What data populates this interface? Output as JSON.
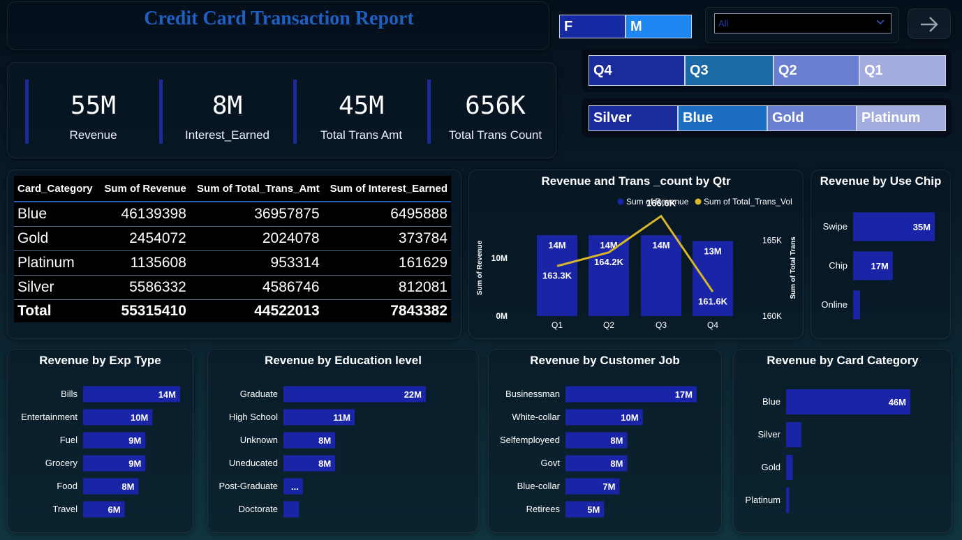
{
  "report_title": "Credit Card Transaction Report",
  "gender_slicer": {
    "options": [
      "F",
      "M"
    ]
  },
  "dropdown": {
    "value": "All"
  },
  "quarter_slicer": {
    "options": [
      "Q4",
      "Q3",
      "Q2",
      "Q1"
    ],
    "colors": [
      "#1a2c9c",
      "#1b6aa6",
      "#6b7fd0",
      "#a3acdf"
    ]
  },
  "category_slicer": {
    "options": [
      "Silver",
      "Blue",
      "Gold",
      "Platinum"
    ],
    "colors": [
      "#1a2c9c",
      "#1b6ec4",
      "#6b7fd0",
      "#a3acdf"
    ]
  },
  "kpis": [
    {
      "value": "55M",
      "label": "Revenue"
    },
    {
      "value": "8M",
      "label": "Interest_Earned"
    },
    {
      "value": "45M",
      "label": "Total Trans Amt"
    },
    {
      "value": "656K",
      "label": "Total Trans Count"
    }
  ],
  "colors": {
    "bar": "#1a24a6",
    "line": "#d9b72a",
    "title": "#1f5fc0"
  },
  "chart_data": [
    {
      "type": "table",
      "columns": [
        "Card_Category",
        "Sum of Revenue",
        "Sum of Total_Trans_Amt",
        "Sum of Interest_Earned"
      ],
      "rows": [
        [
          "Blue",
          "46139398",
          "36957875",
          "6495888"
        ],
        [
          "Gold",
          "2454072",
          "2024078",
          "373784"
        ],
        [
          "Platinum",
          "1135608",
          "953314",
          "161629"
        ],
        [
          "Silver",
          "5586332",
          "4586746",
          "812081"
        ]
      ],
      "total": [
        "Total",
        "55315410",
        "44522013",
        "7843382"
      ]
    },
    {
      "type": "bar+line",
      "title": "Revenue and Trans _count by Qtr",
      "categories": [
        "Q1",
        "Q2",
        "Q3",
        "Q4"
      ],
      "series": [
        {
          "name": "Sum of Revenue",
          "values": [
            14000000,
            14000000,
            14000000,
            13000000
          ],
          "labels": [
            "14M",
            "14M",
            "14M",
            "13M"
          ]
        },
        {
          "name": "Sum of Total_Trans_Vol",
          "values": [
            163300,
            164200,
            166600,
            161600
          ],
          "labels": [
            "163.3K",
            "164.2K",
            "166.6K",
            "161.6K"
          ]
        }
      ],
      "ylabel": "Sum of Revenue",
      "y2label": "Sum of Total Trans",
      "y_ticks": [
        "0M",
        "10M"
      ],
      "y2_ticks": [
        "160K",
        "165K"
      ],
      "ylim": [
        0,
        14500000
      ],
      "y2lim": [
        160000,
        167000
      ],
      "legend_position": "top-right"
    },
    {
      "type": "bar",
      "title": "Revenue by Use Chip",
      "categories": [
        "Swipe",
        "Chip",
        "Online"
      ],
      "values": [
        35000000,
        17000000,
        3000000
      ],
      "labels": [
        "35M",
        "17M",
        ""
      ]
    },
    {
      "type": "bar",
      "title": "Revenue by Exp Type",
      "categories": [
        "Bills",
        "Entertainment",
        "Fuel",
        "Grocery",
        "Food",
        "Travel"
      ],
      "values": [
        14000000,
        10000000,
        9000000,
        9000000,
        8000000,
        6000000
      ],
      "labels": [
        "14M",
        "10M",
        "9M",
        "9M",
        "8M",
        "6M"
      ]
    },
    {
      "type": "bar",
      "title": "Revenue by Education level",
      "categories": [
        "Graduate",
        "High School",
        "Unknown",
        "Uneducated",
        "Post-Graduate",
        "Doctorate"
      ],
      "values": [
        22000000,
        11000000,
        8000000,
        8000000,
        3000000,
        2400000
      ],
      "labels": [
        "22M",
        "11M",
        "8M",
        "8M",
        "...",
        ""
      ]
    },
    {
      "type": "bar",
      "title": "Revenue by Customer Job",
      "categories": [
        "Businessman",
        "White-collar",
        "Selfemployeed",
        "Govt",
        "Blue-collar",
        "Retirees"
      ],
      "values": [
        17000000,
        10000000,
        8000000,
        8000000,
        7000000,
        5000000
      ],
      "labels": [
        "17M",
        "10M",
        "8M",
        "8M",
        "7M",
        "5M"
      ]
    },
    {
      "type": "bar",
      "title": "Revenue by Card Category",
      "categories": [
        "Blue",
        "Silver",
        "Gold",
        "Platinum"
      ],
      "values": [
        46000000,
        5600000,
        2450000,
        1140000
      ],
      "labels": [
        "46M",
        "",
        "",
        ""
      ]
    }
  ]
}
